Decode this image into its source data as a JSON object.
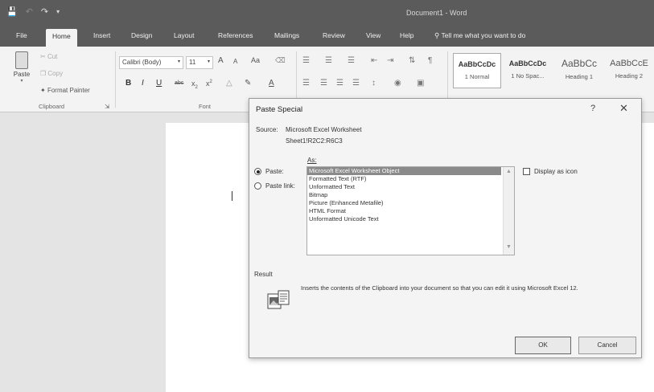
{
  "window": {
    "title": "Document1  -  Word"
  },
  "menu": {
    "file": "File",
    "home": "Home",
    "insert": "Insert",
    "design": "Design",
    "layout": "Layout",
    "references": "References",
    "mailings": "Mailings",
    "review": "Review",
    "view": "View",
    "help": "Help",
    "tellme": "Tell me what you want to do"
  },
  "ribbon": {
    "clipboard": {
      "paste": "Paste",
      "cut": "Cut",
      "copy": "Copy",
      "format_painter": "Format Painter",
      "label": "Clipboard"
    },
    "font": {
      "name": "Calibri (Body)",
      "size": "11",
      "grow": "A",
      "shrink": "A",
      "case": "Aa",
      "bold": "B",
      "italic": "I",
      "underline": "U",
      "strike": "abc",
      "subscript": "x",
      "superscript": "x",
      "label": "Font"
    },
    "styles": [
      {
        "sample": "AaBbCcDc",
        "name": "1 Normal"
      },
      {
        "sample": "AaBbCcDc",
        "name": "1 No Spac..."
      },
      {
        "sample": "AaBbCc",
        "name": "Heading 1"
      },
      {
        "sample": "AaBbCcE",
        "name": "Heading 2"
      }
    ]
  },
  "dialog": {
    "title": "Paste Special",
    "help": "?",
    "close": "✕",
    "source_label": "Source:",
    "source_value": "Microsoft Excel Worksheet",
    "source_range": "Sheet1!R2C2:R6C3",
    "as_label": "As:",
    "paste_label": "Paste:",
    "paste_link_label": "Paste link:",
    "display_as_icon": "Display as icon",
    "options": [
      "Microsoft Excel Worksheet Object",
      "Formatted Text (RTF)",
      "Unformatted Text",
      "Bitmap",
      "Picture (Enhanced Metafile)",
      "HTML Format",
      "Unformatted Unicode Text"
    ],
    "result_label": "Result",
    "result_text": "Inserts the contents of the Clipboard into your document so that you can edit it using Microsoft Excel 12.",
    "ok": "OK",
    "cancel": "Cancel"
  }
}
